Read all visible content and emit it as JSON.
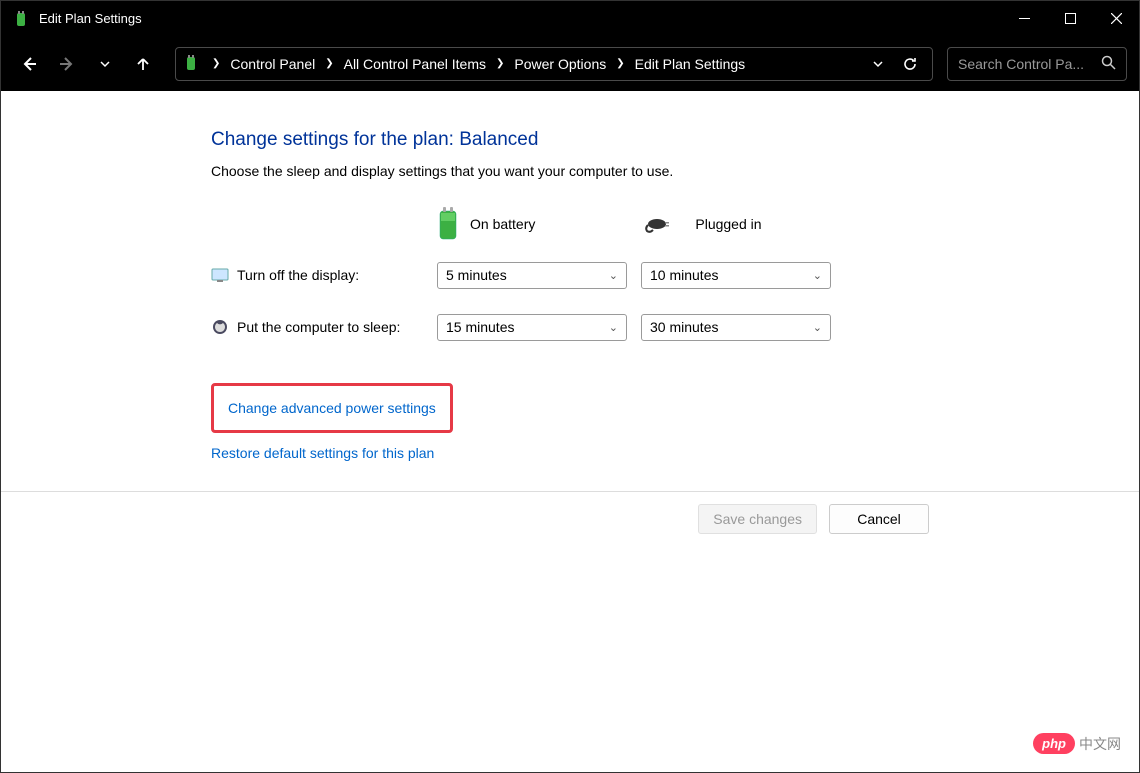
{
  "window": {
    "title": "Edit Plan Settings"
  },
  "breadcrumbs": {
    "items": [
      "Control Panel",
      "All Control Panel Items",
      "Power Options",
      "Edit Plan Settings"
    ]
  },
  "search": {
    "placeholder": "Search Control Pa..."
  },
  "page": {
    "heading": "Change settings for the plan: Balanced",
    "subtext": "Choose the sleep and display settings that you want your computer to use.",
    "col_battery": "On battery",
    "col_plugged": "Plugged in"
  },
  "rows": {
    "display": {
      "label": "Turn off the display:",
      "battery": "5 minutes",
      "plugged": "10 minutes"
    },
    "sleep": {
      "label": "Put the computer to sleep:",
      "battery": "15 minutes",
      "plugged": "30 minutes"
    }
  },
  "links": {
    "advanced": "Change advanced power settings",
    "restore": "Restore default settings for this plan"
  },
  "buttons": {
    "save": "Save changes",
    "cancel": "Cancel"
  },
  "watermark": {
    "brand": "php",
    "text": "中文网"
  }
}
